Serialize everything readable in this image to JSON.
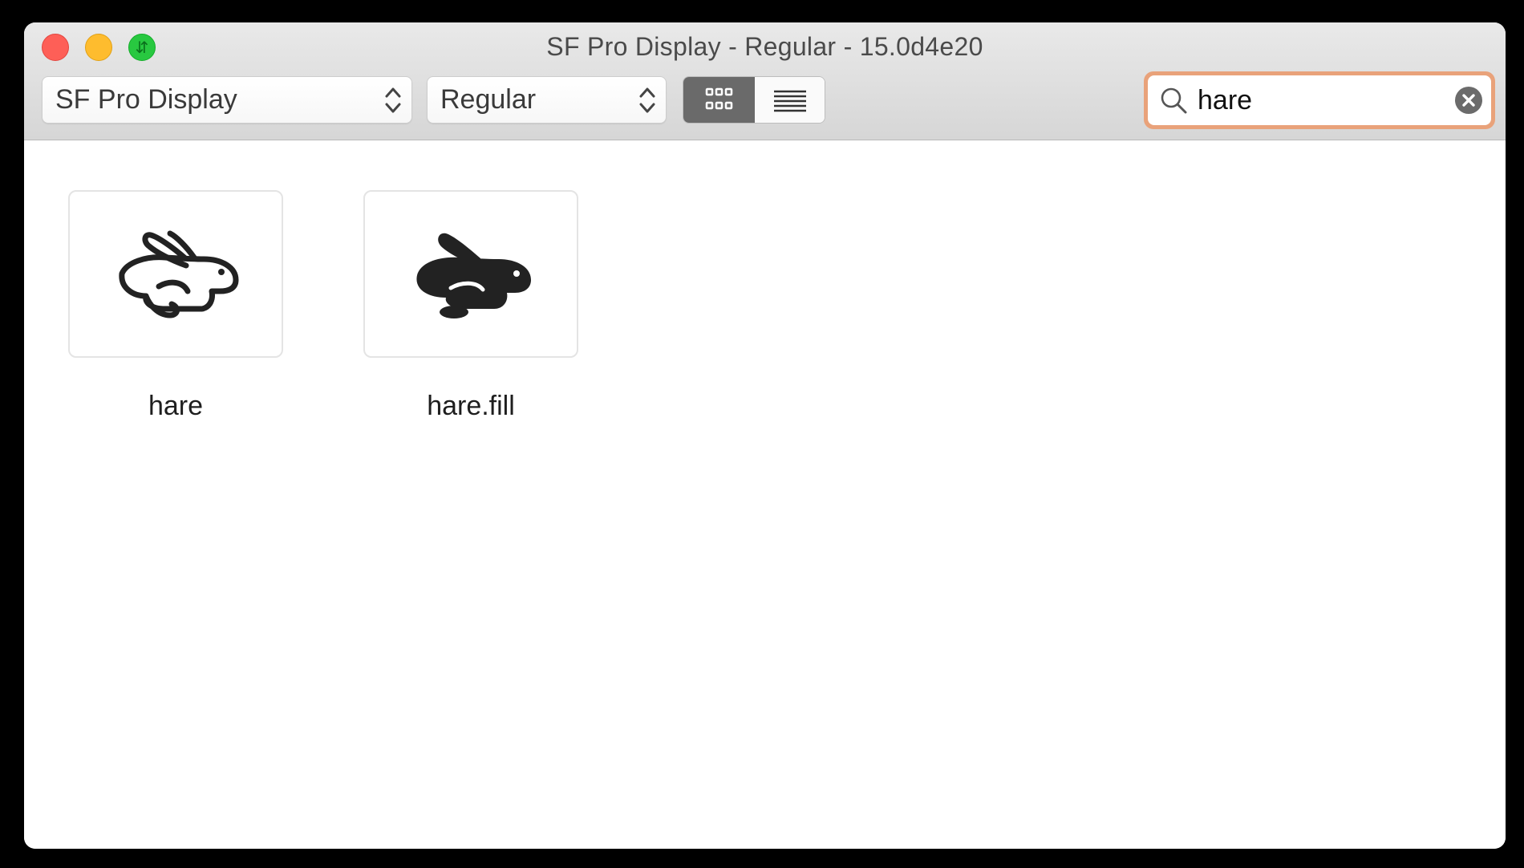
{
  "window": {
    "title": "SF Pro Display - Regular - 15.0d4e20"
  },
  "toolbar": {
    "font_popup": {
      "value": "SF Pro Display",
      "icon": "up-down-chevron-icon"
    },
    "weight_popup": {
      "value": "Regular",
      "icon": "up-down-chevron-icon"
    },
    "view_toggle": {
      "selected": "grid",
      "options": [
        {
          "id": "grid",
          "icon": "grid-view-icon"
        },
        {
          "id": "list",
          "icon": "list-view-icon"
        }
      ]
    },
    "search": {
      "value": "hare",
      "icon": "magnifying-glass-icon",
      "clear_icon": "clear-circle-icon",
      "focus_color": "#e9a27a"
    }
  },
  "symbols": [
    {
      "name": "hare",
      "icon": "hare-icon"
    },
    {
      "name": "hare.fill",
      "icon": "hare-fill-icon"
    }
  ],
  "colors": {
    "close": "#fe5f57",
    "minimize": "#febc2e",
    "zoom": "#28c840",
    "segment_selected": "#6a6a6a"
  }
}
